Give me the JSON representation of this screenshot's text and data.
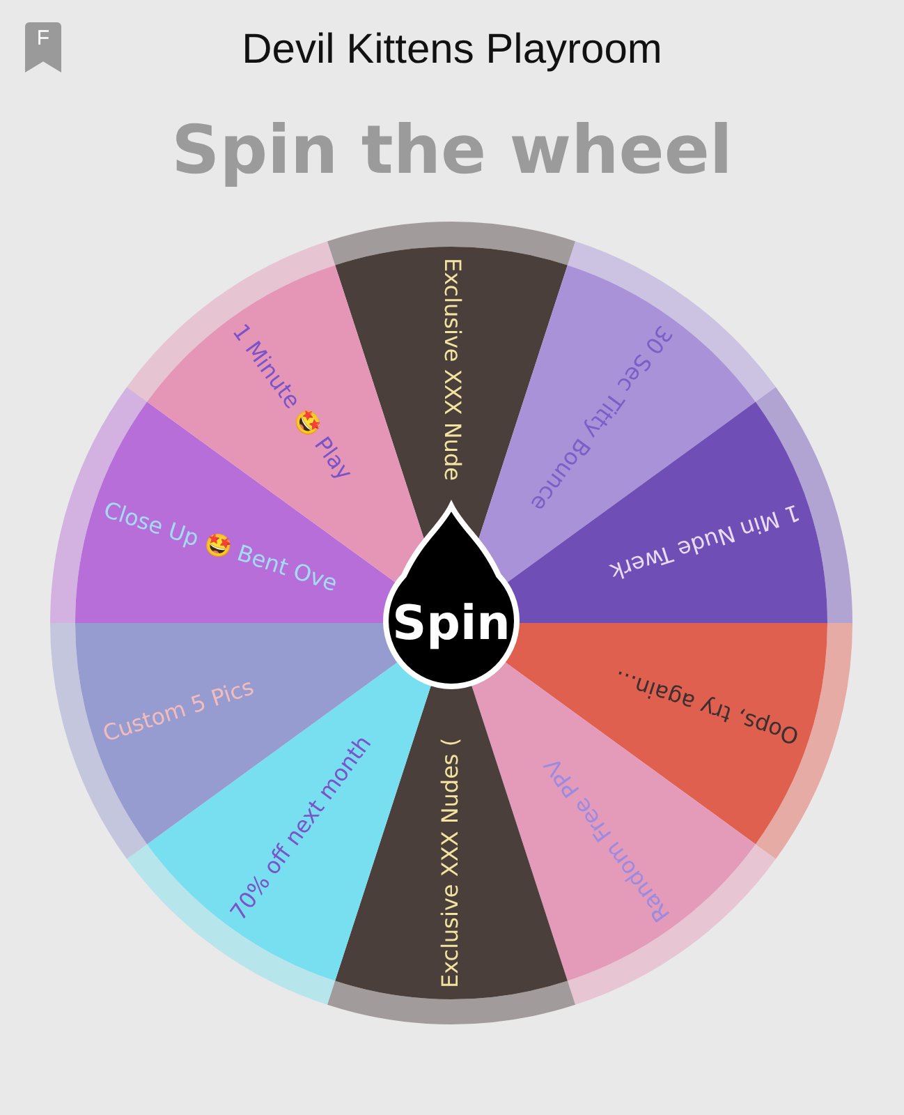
{
  "header": {
    "badge": "F",
    "title": "Devil Kittens Playroom"
  },
  "heading": "Spin the wheel",
  "wheel": {
    "button": "Spin",
    "segments": [
      {
        "color": "#4a3f3b",
        "label": {
          "text": "Exclusive XXX Nude",
          "color": "#f2e3a0"
        }
      },
      {
        "color": "#a992d8",
        "label": {
          "text": "30 Sec Titty Bounce",
          "color": "#7a5fc6"
        }
      },
      {
        "color": "#6f4fb6",
        "label": {
          "text": "1 Min Nude Twerk",
          "color": "#eadcf7"
        }
      },
      {
        "color": "#e06050",
        "label": {
          "text": "Oops, try again...",
          "color": "#3b2f2f"
        }
      },
      {
        "color": "#e49ab9",
        "label": {
          "text": "Random Free PPV",
          "color": "#9a8be0"
        }
      },
      {
        "color": "#4a3f3b",
        "label": {
          "text": "Exclusive XXX Nudes (",
          "color": "#f2e3a0"
        }
      },
      {
        "color": "#78dff0",
        "label": {
          "text": "70% off next month",
          "color": "#7a52c9"
        }
      },
      {
        "color": "#969bd0",
        "label": {
          "text": "Custom 5 Pics",
          "color": "#f2bcbc"
        }
      },
      {
        "color": "#b86ed8",
        "label": {
          "text": "Close Up 🤩 Bent Ove",
          "color": "#a4dcf8"
        }
      },
      {
        "color": "#e596b6",
        "label": {
          "text": "1 Minute 🤩 Play",
          "color": "#7a52c9"
        }
      }
    ]
  }
}
